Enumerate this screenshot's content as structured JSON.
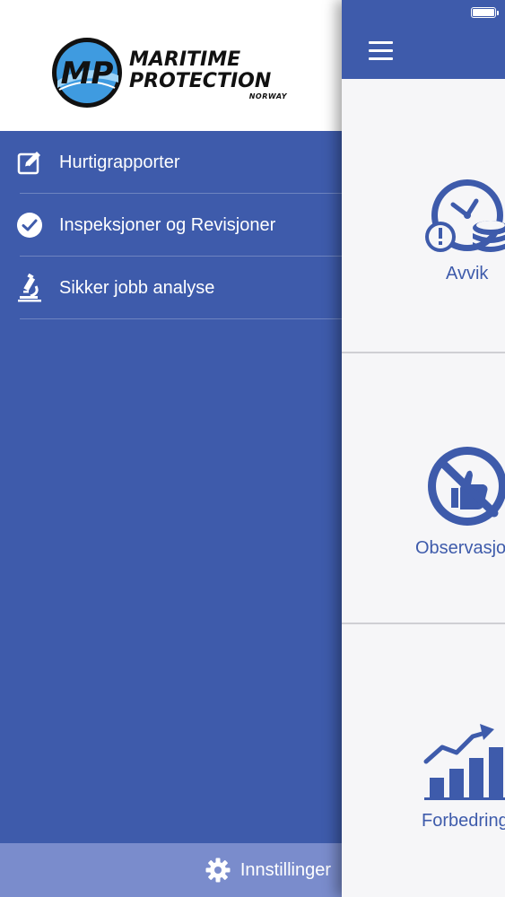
{
  "logo": {
    "line1": "MARITIME",
    "line2": "PROTECTION",
    "line3": "NORWAY",
    "monogram": "MP"
  },
  "menu": {
    "items": [
      {
        "label": "Hurtigrapporter",
        "icon": "edit-icon"
      },
      {
        "label": "Inspeksjoner og Revisjoner",
        "icon": "checkmark-circle-icon"
      },
      {
        "label": "Sikker jobb analyse",
        "icon": "microscope-icon"
      }
    ]
  },
  "settings": {
    "label": "Innstillinger",
    "icon": "gear-icon"
  },
  "main": {
    "tiles": [
      {
        "label": "Avvik",
        "icon": "clock-coins-warning-icon"
      },
      {
        "label": "Observasjo",
        "icon": "no-thumbs-up-icon"
      },
      {
        "label": "Forbedring",
        "icon": "growth-chart-icon"
      }
    ]
  },
  "colors": {
    "brand_blue": "#3e5bab",
    "settings_bar": "#7a8ccc",
    "main_bg": "#f6f6f8"
  }
}
